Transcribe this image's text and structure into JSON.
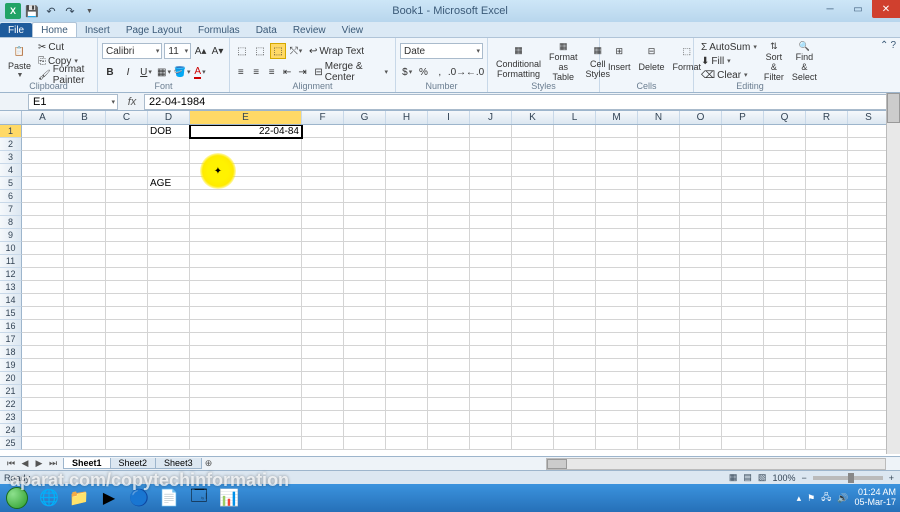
{
  "window": {
    "title": "Book1 - Microsoft Excel"
  },
  "tabs": {
    "file": "File",
    "home": "Home",
    "insert": "Insert",
    "pageLayout": "Page Layout",
    "formulas": "Formulas",
    "data": "Data",
    "review": "Review",
    "view": "View"
  },
  "clipboard": {
    "cut": "Cut",
    "copy": "Copy",
    "formatPainter": "Format Painter",
    "label": "Clipboard"
  },
  "font": {
    "name": "Calibri",
    "size": "11",
    "label": "Font"
  },
  "alignment": {
    "wrapText": "Wrap Text",
    "mergeCenter": "Merge & Center",
    "label": "Alignment"
  },
  "numberGroup": {
    "format": "Date",
    "label": "Number"
  },
  "styles": {
    "condFmt": "Conditional\nFormatting",
    "fmtTable": "Format\nas Table",
    "cellStyles": "Cell\nStyles",
    "label": "Styles"
  },
  "cellsGroup": {
    "insert": "Insert",
    "delete": "Delete",
    "format": "Format",
    "label": "Cells"
  },
  "editing": {
    "autoSum": "AutoSum",
    "fill": "Fill",
    "clear": "Clear",
    "sortFilter": "Sort &\nFilter",
    "findSelect": "Find &\nSelect",
    "label": "Editing"
  },
  "nameBox": "E1",
  "formula": "22-04-1984",
  "columns": [
    "A",
    "B",
    "C",
    "D",
    "E",
    "F",
    "G",
    "H",
    "I",
    "J",
    "K",
    "L",
    "M",
    "N",
    "O",
    "P",
    "Q",
    "R",
    "S"
  ],
  "activeCol": "E",
  "activeRow": 1,
  "cells": {
    "D1": "DOB",
    "E1": "22-04-84",
    "D5": "AGE"
  },
  "sheets": {
    "s1": "Sheet1",
    "s2": "Sheet2",
    "s3": "Sheet3"
  },
  "status": {
    "ready": "Ready",
    "zoom": "100%"
  },
  "tray": {
    "time": "01:24 AM",
    "date": "05-Mar-17"
  },
  "watermark": "aparat.com/copytechinformation"
}
